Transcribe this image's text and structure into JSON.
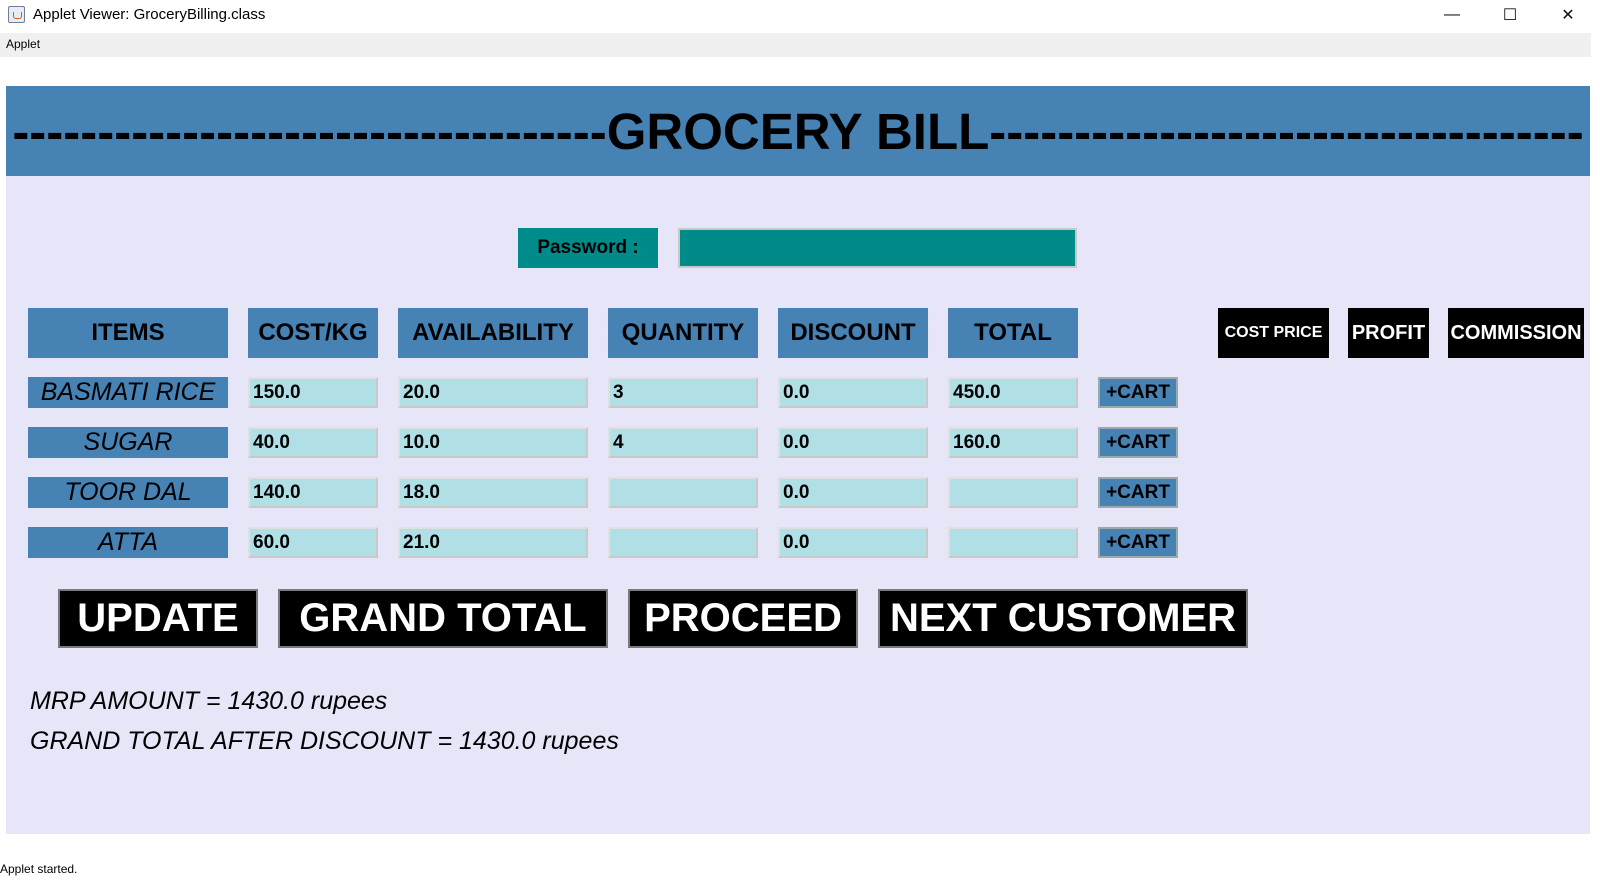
{
  "window": {
    "title": "Applet Viewer: GroceryBilling.class",
    "controls": {
      "minimize": "—",
      "maximize": "☐",
      "close": "✕"
    }
  },
  "menu": {
    "applet": "Applet"
  },
  "header": {
    "title": "-----------------------------------GROCERY BILL-----------------------------------"
  },
  "password": {
    "label": "Password :",
    "value": ""
  },
  "columns": [
    "ITEMS",
    "COST/KG",
    "AVAILABILITY",
    "QUANTITY",
    "DISCOUNT",
    "TOTAL"
  ],
  "side_buttons": {
    "cost_price": "COST PRICE",
    "profit": "PROFIT",
    "commission": "COMMISSION"
  },
  "items": [
    {
      "name": "BASMATI RICE",
      "cost": "150.0",
      "availability": "20.0",
      "quantity": "3",
      "discount": "0.0",
      "total": "450.0",
      "cart": "+CART"
    },
    {
      "name": "SUGAR",
      "cost": "40.0",
      "availability": "10.0",
      "quantity": "4",
      "discount": "0.0",
      "total": "160.0",
      "cart": "+CART"
    },
    {
      "name": "TOOR DAL",
      "cost": "140.0",
      "availability": "18.0",
      "quantity": "",
      "discount": "0.0",
      "total": "",
      "cart": "+CART"
    },
    {
      "name": "ATTA",
      "cost": "60.0",
      "availability": "21.0",
      "quantity": "",
      "discount": "0.0",
      "total": "",
      "cart": "+CART"
    }
  ],
  "actions": {
    "update": "UPDATE",
    "grand_total": "GRAND TOTAL",
    "proceed": "PROCEED",
    "next_customer": "NEXT CUSTOMER"
  },
  "summary": {
    "mrp": "MRP AMOUNT = 1430.0 rupees",
    "grand_total": "GRAND TOTAL AFTER DISCOUNT = 1430.0 rupees"
  },
  "status": "Applet started.",
  "colors": {
    "header": "#4682b4",
    "panel": "#e6e6f8",
    "password_field": "#008b8b",
    "cell": "#b0e0e6",
    "button": "#000000"
  }
}
